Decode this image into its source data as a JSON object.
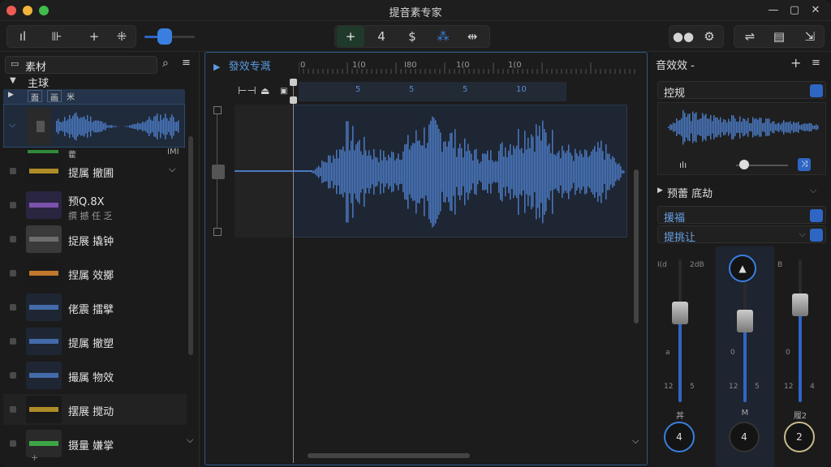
{
  "window": {
    "title": "提音素专家"
  },
  "toolbar": {
    "transport_icons": [
      "+",
      "4",
      "$"
    ],
    "colors": {
      "accent": "#2f66c4",
      "wave": "#4a78c0",
      "active_bg": "#1f3a2a"
    }
  },
  "library": {
    "header_label": "素材",
    "group_label": "主球",
    "tabs": [
      "面",
      "画",
      "米"
    ],
    "meta_left": "藿",
    "meta_right": "IMI",
    "items": [
      {
        "label": "提属 撤圃"
      },
      {
        "label": "预Q.8X",
        "sub": "撰 撼 任 乏"
      },
      {
        "label": "捉展 撬钟"
      },
      {
        "label": "捏属 效擲"
      },
      {
        "label": "佬震 擂擘"
      },
      {
        "label": "提属 撤塑"
      },
      {
        "label": "撮属 物效"
      },
      {
        "label": "摆展 搅动"
      },
      {
        "label": "摄量 嫌掌"
      }
    ]
  },
  "editor": {
    "title": "發效专溉",
    "ruler_labels": [
      "0",
      "1(0",
      "I80",
      "1(0",
      "1(0"
    ],
    "ruler_sub": [
      "5",
      "5",
      "5",
      "10"
    ]
  },
  "effects": {
    "title": "音效效 -",
    "preset": "控规",
    "section_label": "预蕾 底劫",
    "param1": "援福",
    "param2": "提挑让",
    "channels": [
      {
        "top_left": "I(d",
        "top_right": "2dB",
        "mid": "a",
        "bot_left": "12",
        "bot_right": "5",
        "name": "丼",
        "knob": "4"
      },
      {
        "top_left": "",
        "top_right": "",
        "mid": "0",
        "bot_left": "12",
        "bot_right": "5",
        "name": "M",
        "knob": "4"
      },
      {
        "top_left": "B",
        "top_right": "",
        "mid": "0",
        "bot_left": "12",
        "bot_right": "4",
        "name": "履2",
        "knob": "2"
      }
    ]
  }
}
